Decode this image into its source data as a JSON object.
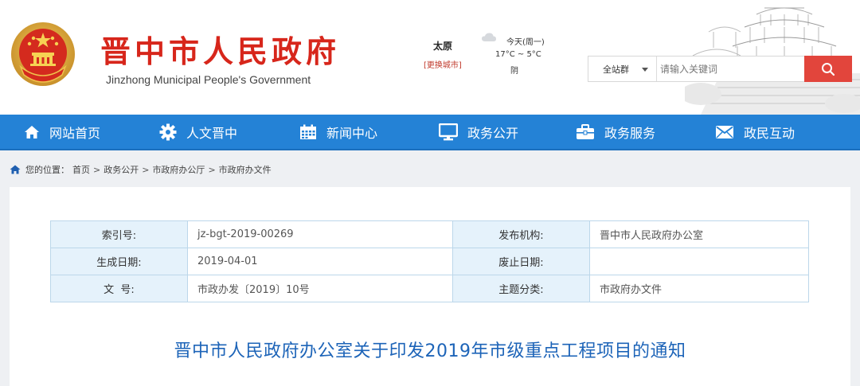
{
  "header": {
    "title": "晋中市人民政府",
    "subtitle": "Jinzhong Municipal People's Government",
    "weather": {
      "city": "太原",
      "change_city": "[更换城市]",
      "day": "今天(周一)",
      "temperature": "17°C ~ 5°C",
      "condition": "阴",
      "icon": "cloudy-icon"
    },
    "search": {
      "scope": "全站群",
      "placeholder": "请输入关键词",
      "button_icon": "search-icon"
    }
  },
  "nav": {
    "items": [
      {
        "label": "网站首页",
        "icon": "home-icon"
      },
      {
        "label": "人文晋中",
        "icon": "gear-icon"
      },
      {
        "label": "新闻中心",
        "icon": "calendar-icon"
      },
      {
        "label": "政务公开",
        "icon": "monitor-icon"
      },
      {
        "label": "政务服务",
        "icon": "briefcase-icon"
      },
      {
        "label": "政民互动",
        "icon": "envelope-icon"
      }
    ]
  },
  "breadcrumb": {
    "prefix": "您的位置：",
    "items": [
      "首页",
      "政务公开",
      "市政府办公厅",
      "市政府办文件"
    ],
    "separator": ">"
  },
  "meta": {
    "rows": [
      {
        "label1": "索引号:",
        "value1": "jz-bgt-2019-00269",
        "label2": "发布机构:",
        "value2": "晋中市人民政府办公室"
      },
      {
        "label1": "生成日期:",
        "value1": "2019-04-01",
        "label2": "废止日期:",
        "value2": ""
      },
      {
        "label1": "文  号:",
        "value1": "市政办发〔2019〕10号",
        "label2": "主题分类:",
        "value2": "市政府办文件"
      }
    ]
  },
  "document": {
    "title": "晋中市人民政府办公室关于印发2019年市级重点工程项目的通知"
  },
  "colors": {
    "brand_red": "#d7261b",
    "nav_blue": "#2482d6",
    "title_blue": "#1d64b8",
    "search_red": "#e2453c"
  }
}
